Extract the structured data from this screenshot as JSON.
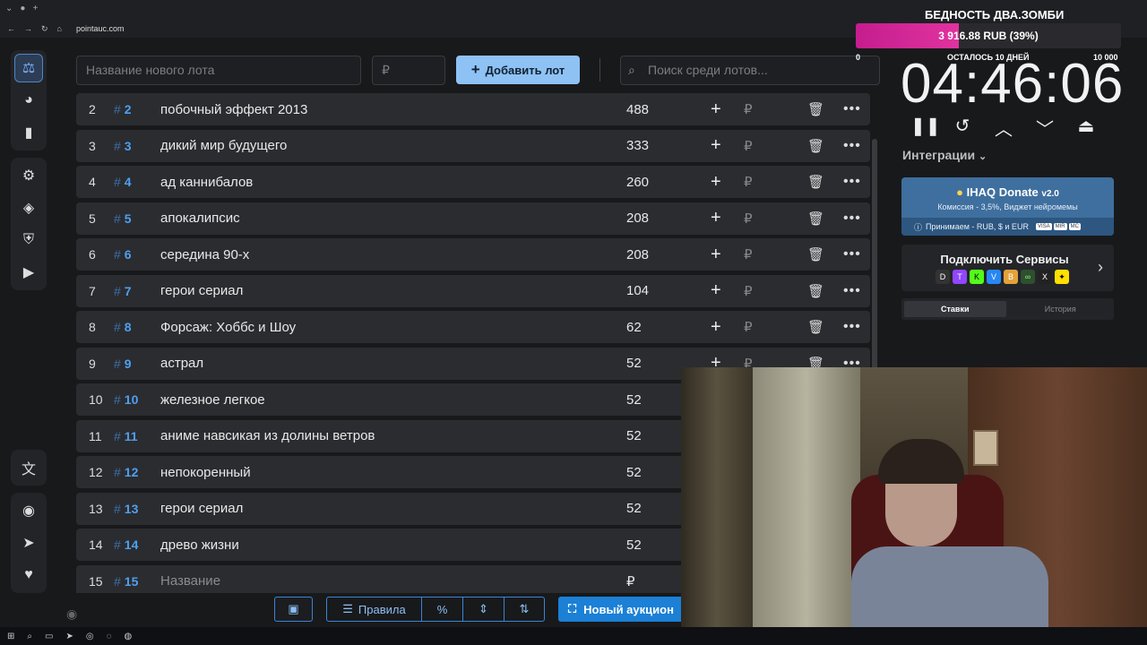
{
  "browser": {
    "url": "pointauc.com"
  },
  "toolbar": {
    "new_lot_placeholder": "Название нового лота",
    "price_placeholder": "₽",
    "add_button_label": "Добавить лот",
    "search_placeholder": "Поиск среди лотов..."
  },
  "lots": [
    {
      "num": "2",
      "tag": "2",
      "name": "побочный эффект 2013",
      "amount": "488"
    },
    {
      "num": "3",
      "tag": "3",
      "name": "дикий мир будущего",
      "amount": "333"
    },
    {
      "num": "4",
      "tag": "4",
      "name": "ад каннибалов",
      "amount": "260"
    },
    {
      "num": "5",
      "tag": "5",
      "name": "апокалипсис",
      "amount": "208"
    },
    {
      "num": "6",
      "tag": "6",
      "name": "середина 90-х",
      "amount": "208"
    },
    {
      "num": "7",
      "tag": "7",
      "name": "герои сериал",
      "amount": "104"
    },
    {
      "num": "8",
      "tag": "8",
      "name": "Форсаж: Хоббс и Шоу",
      "amount": "62"
    },
    {
      "num": "9",
      "tag": "9",
      "name": "астрал",
      "amount": "52"
    },
    {
      "num": "10",
      "tag": "10",
      "name": "железное легкое",
      "amount": "52"
    },
    {
      "num": "11",
      "tag": "11",
      "name": "аниме навсикая из долины ветров",
      "amount": "52"
    },
    {
      "num": "12",
      "tag": "12",
      "name": "непокоренный",
      "amount": "52"
    },
    {
      "num": "13",
      "tag": "13",
      "name": "герои сериал",
      "amount": "52"
    },
    {
      "num": "14",
      "tag": "14",
      "name": "древо жизни",
      "amount": "52"
    },
    {
      "num": "15",
      "tag": "15",
      "name": "Название",
      "amount": "₽"
    }
  ],
  "bottom": {
    "rules_label": "Правила",
    "new_auction_label": "Новый аукцион"
  },
  "goal": {
    "title": "БЕДНОСТЬ ДВА.ЗОМБИ",
    "progress_text": "3 916.88 RUB (39%)",
    "progress_fraction": 0.39,
    "min": "0",
    "left": "ОСТАЛОСЬ 10 ДНЕЙ",
    "max": "10 000"
  },
  "timer": {
    "value": "04:46:06"
  },
  "integrations": {
    "label": "Интеграции",
    "donate_title": "IHAQ Donate",
    "donate_version": "v2.0",
    "donate_sub": "Комиссия - 3,5%, Виджет нейромемы",
    "donate_accept": "Принимаем - RUB, $ и EUR",
    "services_title": "Подключить Сервисы",
    "tab_bets": "Ставки",
    "tab_history": "История"
  }
}
